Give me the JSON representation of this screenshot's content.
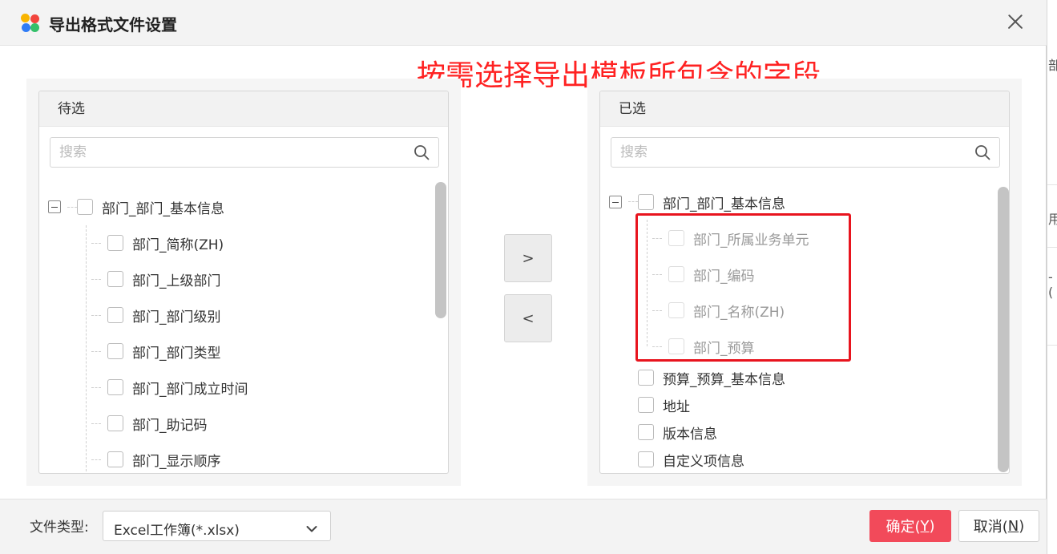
{
  "dialog": {
    "title": "导出格式文件设置",
    "annotation": "按需选择导出模板所包含的字段"
  },
  "left_panel": {
    "header": "待选",
    "search_placeholder": "搜索",
    "root": "部门_部门_基本信息",
    "children": [
      "部门_简称(ZH)",
      "部门_上级部门",
      "部门_部门级别",
      "部门_部门类型",
      "部门_部门成立时间",
      "部门_助记码",
      "部门_显示顺序"
    ]
  },
  "right_panel": {
    "header": "已选",
    "search_placeholder": "搜索",
    "root": "部门_部门_基本信息",
    "children": [
      "部门_所属业务单元",
      "部门_编码",
      "部门_名称(ZH)",
      "部门_预算"
    ],
    "others": [
      "预算_预算_基本信息",
      "地址",
      "版本信息",
      "自定义项信息"
    ]
  },
  "transfer": {
    "add_label": ">",
    "remove_label": "<"
  },
  "footer": {
    "file_type_label": "文件类型:",
    "file_type_value": "Excel工作簿(*.xlsx)",
    "ok_text": "确定(",
    "ok_key": "Y",
    "ok_end": ")",
    "cancel_text": "取消(",
    "cancel_key": "N",
    "cancel_end": ")"
  },
  "background": {
    "fragments": [
      "部",
      "用",
      "-("
    ]
  },
  "icons": {
    "app_logo": "app-logo-icon",
    "close": "close-icon",
    "search": "search-icon",
    "collapse": "collapse-icon",
    "dropdown": "chevron-down-icon"
  },
  "colors": {
    "primary_button": "#f24a5a",
    "annotation_text": "#ff2222",
    "highlight_border": "#e8141e"
  }
}
